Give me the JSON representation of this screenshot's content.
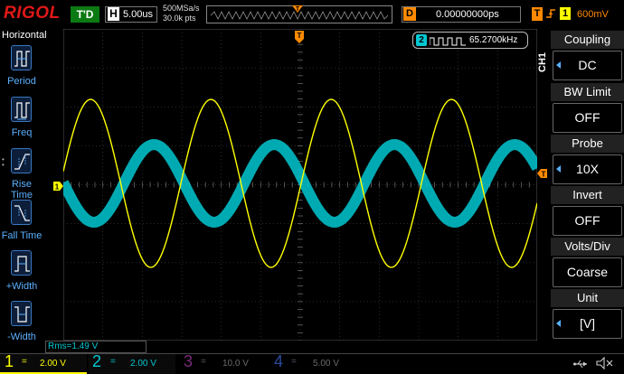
{
  "header": {
    "logo": "RIGOL",
    "trigger_status": "T'D",
    "h_label": "H",
    "h_value": "5.00us",
    "sample_rate": "500MSa/s",
    "memory_depth": "30.0k pts",
    "d_label": "D",
    "d_value": "0.00000000ps",
    "t_label": "T",
    "t_channel": "1",
    "t_level": "600mV",
    "t_marker": "T"
  },
  "left_menu": {
    "title": "Horizontal",
    "items": [
      {
        "label": "Period",
        "icon": "period-icon"
      },
      {
        "label": "Freq",
        "icon": "freq-icon"
      },
      {
        "label": "Rise Time",
        "icon": "rise-time-icon"
      },
      {
        "label": "Fall Time",
        "icon": "fall-time-icon"
      },
      {
        "label": "+Width",
        "icon": "pos-width-icon"
      },
      {
        "label": "-Width",
        "icon": "neg-width-icon"
      }
    ]
  },
  "screen": {
    "freq_channel": "2",
    "freq_readout": "65.2700kHz",
    "ch1_marker": "1",
    "trig_marker": "T"
  },
  "right_menu": {
    "channel_tag": "CH1",
    "items": [
      {
        "title": "Coupling",
        "value": "DC",
        "has_arrow": true
      },
      {
        "title": "BW Limit",
        "value": "OFF",
        "has_arrow": false
      },
      {
        "title": "Probe",
        "value": "10X",
        "has_arrow": true
      },
      {
        "title": "Invert",
        "value": "OFF",
        "has_arrow": false
      },
      {
        "title": "Volts/Div",
        "value": "Coarse",
        "has_arrow": false
      },
      {
        "title": "Unit",
        "value": "[V]",
        "has_arrow": true
      }
    ]
  },
  "bottom": {
    "rms": "Rms=1.49 V",
    "channels": [
      {
        "num": "1",
        "coupling": "=",
        "scale": "2.00 V",
        "color": "#ffff00",
        "active": true
      },
      {
        "num": "2",
        "coupling": "=",
        "scale": "2.00 V",
        "color": "#00c8d2",
        "active": true
      },
      {
        "num": "3",
        "coupling": "=",
        "scale": "10.0 V",
        "color": "#c040c0",
        "active": false
      },
      {
        "num": "4",
        "coupling": "=",
        "scale": "5.00 V",
        "color": "#2a5aff",
        "active": false
      }
    ]
  },
  "colors": {
    "ch1": "#ffff00",
    "ch2": "#00c8d2",
    "trigger": "#ff8a00",
    "softkey_text": "#5ab0ff"
  }
}
